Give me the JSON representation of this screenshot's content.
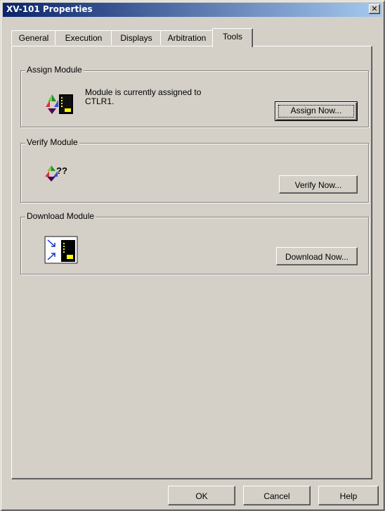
{
  "window": {
    "title": "XV-101 Properties",
    "close_glyph": "✕"
  },
  "tabs": [
    {
      "label": "General",
      "active": false
    },
    {
      "label": "Execution",
      "active": false
    },
    {
      "label": "Displays",
      "active": false
    },
    {
      "label": "Arbitration",
      "active": false
    },
    {
      "label": "Tools",
      "active": true
    }
  ],
  "assign": {
    "group_label": "Assign Module",
    "message_line1": "Module is currently assigned to",
    "message_line2": "CTLR1.",
    "button_label": "Assign Now...",
    "icon": "assign-module-icon"
  },
  "verify": {
    "group_label": "Verify Module",
    "status_text": "??",
    "button_label": "Verify Now...",
    "icon": "verify-module-icon"
  },
  "download": {
    "group_label": "Download Module",
    "button_label": "Download Now...",
    "icon": "download-module-icon"
  },
  "footer": {
    "ok_label": "OK",
    "cancel_label": "Cancel",
    "help_label": "Help"
  },
  "colors": {
    "face": "#d4d0c8",
    "title_start": "#0a246a",
    "title_end": "#a6caf0"
  }
}
